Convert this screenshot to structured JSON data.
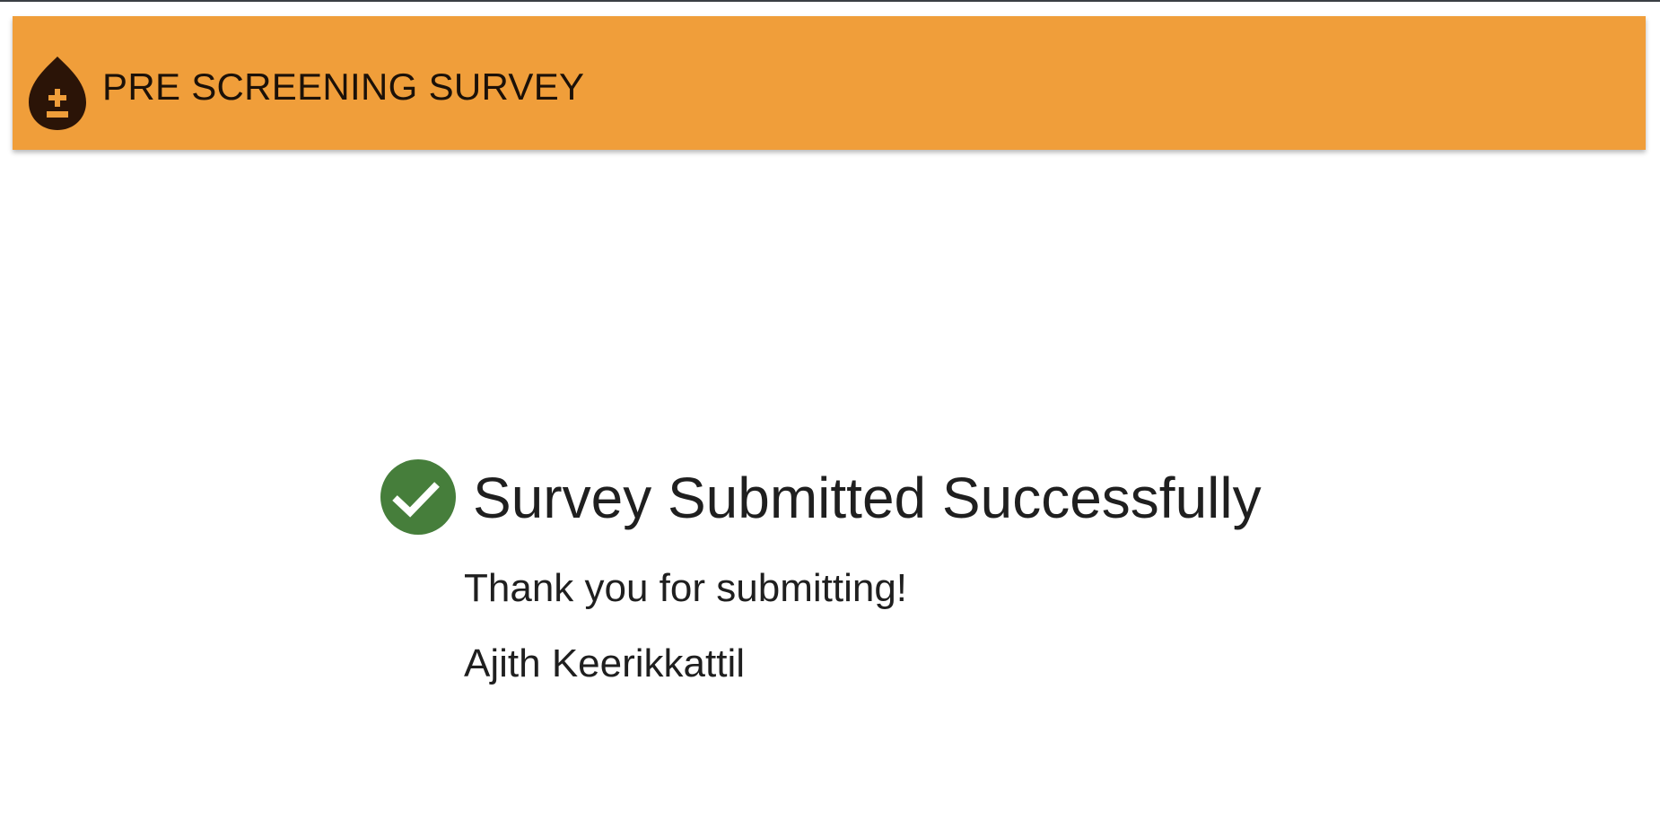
{
  "header": {
    "title": "PRE SCREENING SURVEY",
    "background_color": "#f09e3a",
    "logo_icon": "blood-drop-plus-minus-icon"
  },
  "confirmation": {
    "icon": "check-circle-icon",
    "icon_color": "#467e3b",
    "title": "Survey Submitted Successfully",
    "message": "Thank you for submitting!",
    "user_name": "Ajith Keerikkattil"
  }
}
